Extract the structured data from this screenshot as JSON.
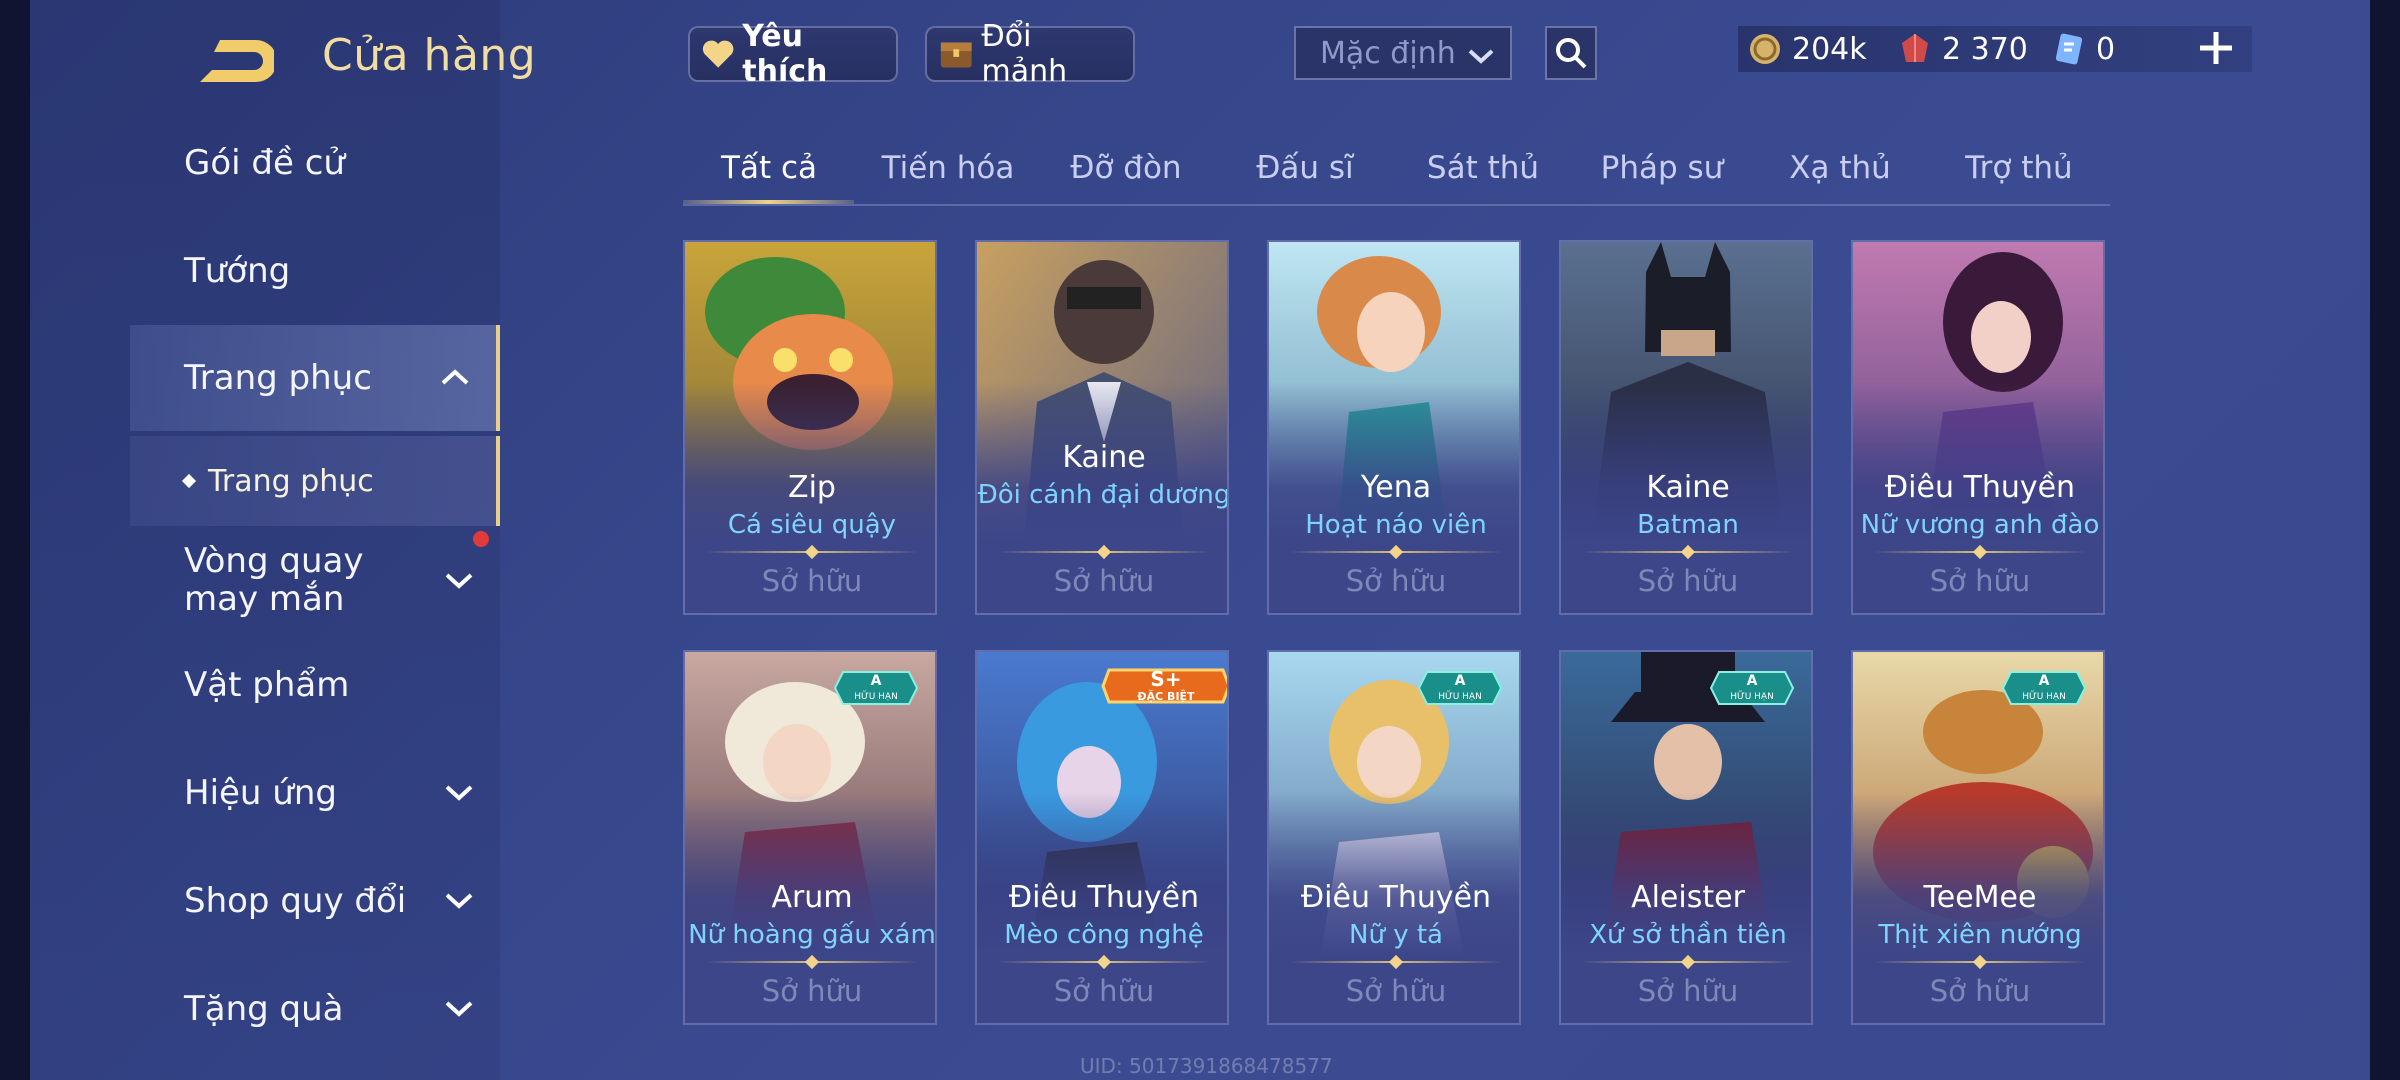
{
  "header": {
    "title": "Cửa hàng",
    "favorite_label": "Yêu thích",
    "shard_label": "Đổi mảnh",
    "sort_value": "Mặc định",
    "currencies": [
      {
        "icon": "gold-coin-icon",
        "value": "204k"
      },
      {
        "icon": "red-gem-icon",
        "value": "2 370"
      },
      {
        "icon": "voucher-icon",
        "value": "0"
      }
    ]
  },
  "sidebar": {
    "items": [
      {
        "label": "Gói đề cử"
      },
      {
        "label": "Tướng"
      },
      {
        "label": "Trang phục"
      },
      {
        "label": "Vòng quay may mắn"
      },
      {
        "label": "Vật phẩm"
      },
      {
        "label": "Hiệu ứng"
      },
      {
        "label": "Shop quy đổi"
      },
      {
        "label": "Tặng quà"
      }
    ],
    "sub_item": "Trang phục"
  },
  "tabs": [
    "Tất cả",
    "Tiến hóa",
    "Đỡ đòn",
    "Đấu sĩ",
    "Sát thủ",
    "Pháp sư",
    "Xạ thủ",
    "Trợ thủ"
  ],
  "cards": [
    {
      "hero": "Zip",
      "skin": "Cá siêu quậy",
      "status": "Sở hữu"
    },
    {
      "hero": "Kaine",
      "skin": "Đôi cánh đại dương",
      "status": "Sở hữu"
    },
    {
      "hero": "Yena",
      "skin": "Hoạt náo viên",
      "status": "Sở hữu"
    },
    {
      "hero": "Kaine",
      "skin": "Batman",
      "status": "Sở hữu"
    },
    {
      "hero": "Điêu Thuyền",
      "skin": "Nữ vương anh đào",
      "status": "Sở hữu"
    },
    {
      "hero": "Arum",
      "skin": "Nữ hoàng gấu xám",
      "status": "Sở hữu",
      "badge": "A",
      "badge_sub": "HỮU HẠN"
    },
    {
      "hero": "Điêu Thuyền",
      "skin": "Mèo công nghệ",
      "status": "Sở hữu",
      "badge": "S+",
      "badge_sub": "ĐẶC BIỆT"
    },
    {
      "hero": "Điêu Thuyền",
      "skin": "Nữ y tá",
      "status": "Sở hữu",
      "badge": "A",
      "badge_sub": "HỮU HẠN"
    },
    {
      "hero": "Aleister",
      "skin": "Xứ sở thần tiên",
      "status": "Sở hữu",
      "badge": "A",
      "badge_sub": "HỮU HẠN"
    },
    {
      "hero": "TeeMee",
      "skin": "Thịt xiên nướng",
      "status": "Sở hữu",
      "badge": "A",
      "badge_sub": "HỮU HẠN"
    }
  ],
  "uid": "UID: 5017391868478577",
  "colors": {
    "accent_gold": "#f1dca2",
    "skin_name": "#7fd4ff",
    "owned_text": "#7f88b9",
    "badge_teal": "#1a8f8a",
    "badge_orange": "#e86a1c"
  }
}
